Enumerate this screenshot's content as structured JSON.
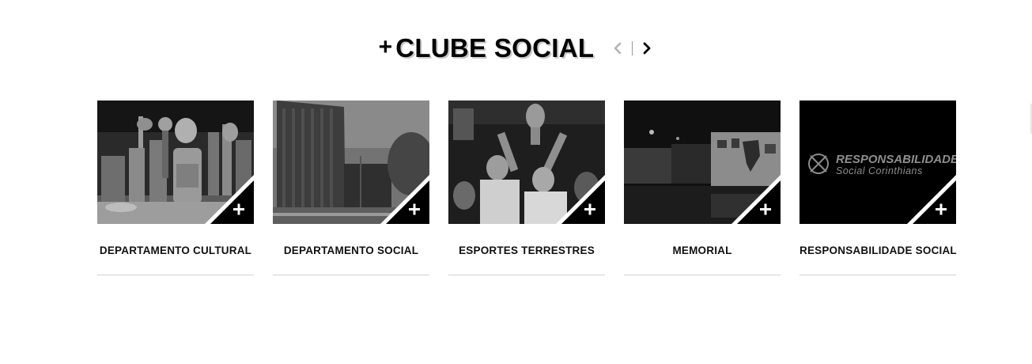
{
  "section": {
    "plus": "+",
    "title": "CLUBE SOCIAL",
    "prev_icon": "chevron-left-icon",
    "next_icon": "chevron-right-icon"
  },
  "colors": {
    "accent": "#000000",
    "divider": "#d2d2d2",
    "nav_disabled": "#b3b3b3"
  },
  "cards": [
    {
      "label": "DEPARTAMENTO CULTURAL",
      "image": "trophies-photo"
    },
    {
      "label": "DEPARTAMENTO SOCIAL",
      "image": "building-photo"
    },
    {
      "label": "ESPORTES TERRESTRES",
      "image": "trophy-celebration-photo"
    },
    {
      "label": "MEMORIAL",
      "image": "memorial-exhibit-photo"
    },
    {
      "label": "RESPONSABILIDADE SOCIAL",
      "image": "responsabilidade-logo",
      "logo_line1": "RESPONSABILIDADE",
      "logo_line2": "Social Corinthians"
    }
  ]
}
